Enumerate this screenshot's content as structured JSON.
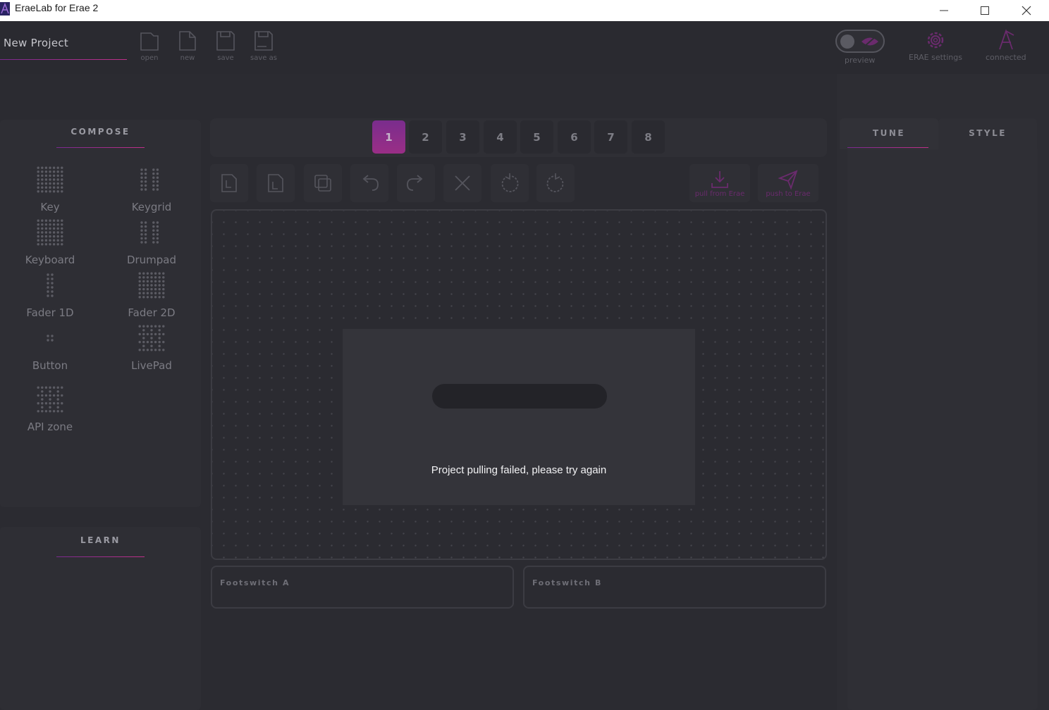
{
  "window": {
    "title": "EraeLab for Erae 2",
    "controls": {
      "minimize": "minimize-icon",
      "maximize": "maximize-icon",
      "close": "close-icon"
    }
  },
  "topbar": {
    "project_name": "New Project",
    "file_buttons": [
      {
        "label": "open",
        "icon": "folder-icon"
      },
      {
        "label": "new",
        "icon": "new-file-icon"
      },
      {
        "label": "save",
        "icon": "save-icon"
      },
      {
        "label": "save as",
        "icon": "save-as-icon"
      }
    ],
    "preview_label": "preview",
    "settings_label": "ERAE settings",
    "connection_label": "connected"
  },
  "compose": {
    "heading": "COMPOSE",
    "widgets": [
      {
        "label": "Key",
        "icon": "key-dots-icon"
      },
      {
        "label": "Keygrid",
        "icon": "keygrid-dots-icon"
      },
      {
        "label": "Keyboard",
        "icon": "keyboard-dots-icon"
      },
      {
        "label": "Drumpad",
        "icon": "drumpad-dots-icon"
      },
      {
        "label": "Fader 1D",
        "icon": "fader-1d-dots-icon"
      },
      {
        "label": "Fader 2D",
        "icon": "fader-2d-dots-icon"
      },
      {
        "label": "Button",
        "icon": "button-dots-icon"
      },
      {
        "label": "LivePad",
        "icon": "livepad-dots-icon"
      },
      {
        "label": "API zone",
        "icon": "api-zone-dots-icon"
      }
    ]
  },
  "learn": {
    "heading": "LEARN"
  },
  "pages": {
    "tabs": [
      "1",
      "2",
      "3",
      "4",
      "5",
      "6",
      "7",
      "8"
    ],
    "active": "1"
  },
  "toolbar": {
    "tools": [
      "export-layout-icon",
      "import-layout-icon",
      "duplicate-icon",
      "undo-icon",
      "redo-icon",
      "delete-icon",
      "rotate-left-icon",
      "rotate-right-icon"
    ],
    "pull_label": "pull from Erae",
    "push_label": "push to Erae"
  },
  "footswitches": [
    "Footswitch A",
    "Footswitch B"
  ],
  "right_panel": {
    "tabs": [
      "TUNE",
      "STYLE"
    ],
    "active": "TUNE"
  },
  "modal": {
    "message": "Project pulling failed, please try again"
  },
  "colors": {
    "accent": "#9a2e86",
    "accent_line": "#c0308a",
    "background": "#2b2b31",
    "panel": "#2e2e34"
  }
}
